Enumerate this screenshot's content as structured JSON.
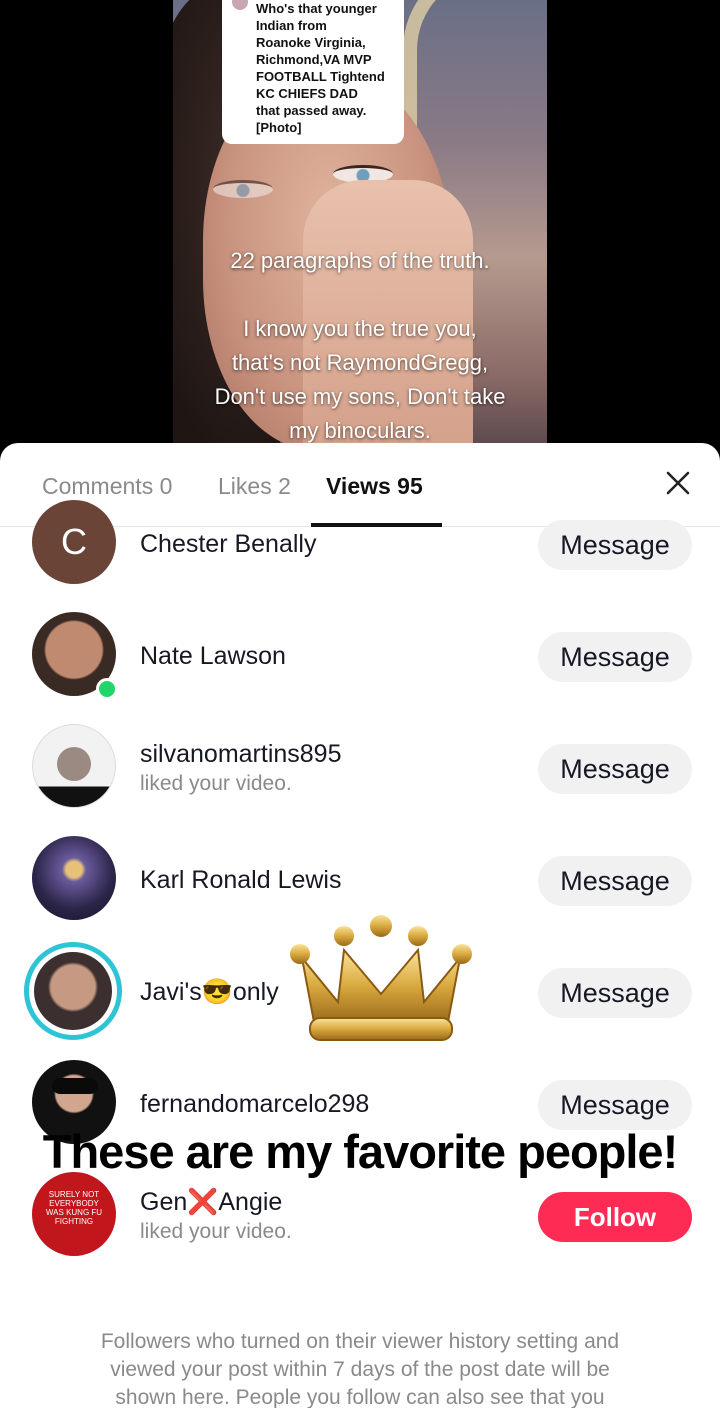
{
  "video": {
    "question_card": "Who's that younger\nIndian from\nRoanoke Virginia,\nRichmond,VA MVP\nFOOTBALL Tightend\nKC CHIEFS DAD\nthat passed away.\n[Photo]",
    "overlay_text": "22 paragraphs of the truth.\n\nI know you the true you,\nthat's not RaymondGregg,\nDon't use my sons, Don't take\nmy binoculars."
  },
  "tabs": [
    {
      "label": "Comments 0",
      "active": false
    },
    {
      "label": "Likes 2",
      "active": false
    },
    {
      "label": "Views 95",
      "active": true
    }
  ],
  "close_icon": "close-icon",
  "viewers": [
    {
      "name": "Chester Benally",
      "subtitle": "",
      "button": "Message",
      "avatar_letter": "C",
      "online": false
    },
    {
      "name": "Nate Lawson",
      "subtitle": "",
      "button": "Message",
      "online": true
    },
    {
      "name": "silvanomartins895",
      "subtitle": "liked your video.",
      "button": "Message",
      "online": false
    },
    {
      "name": "Karl Ronald Lewis",
      "subtitle": "",
      "button": "Message",
      "online": false
    },
    {
      "name": "Javi's😎only",
      "subtitle": "",
      "button": "Message",
      "online": false,
      "ring": true
    },
    {
      "name": "fernandomarcelo298",
      "subtitle": "",
      "button": "Message",
      "online": false
    },
    {
      "name": "Gen❌Angie",
      "subtitle": "liked your video.",
      "button": "Follow",
      "online": false,
      "avatar_text": "SURELY NOT\nEVERYBODY\nWAS KUNG FU\nFIGHTING"
    }
  ],
  "overlay_caption": "These are my favorite people!",
  "footer_note": "Followers who turned on their viewer history setting and\nviewed your post within 7 days of the post date will be\nshown here. People you follow can also see that you",
  "colors": {
    "follow": "#fe2c55",
    "online": "#20d56a",
    "ring": "#2ec4d6"
  }
}
